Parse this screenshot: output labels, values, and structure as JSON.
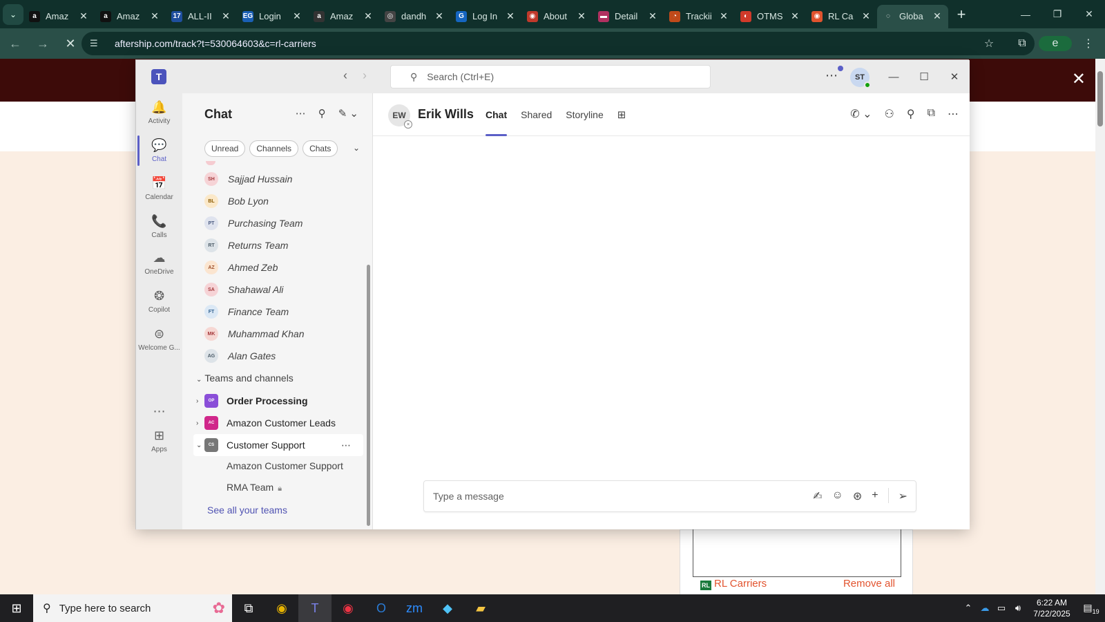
{
  "browser": {
    "tabs": [
      {
        "label": "Amaz",
        "fav": "a",
        "color": "#111111"
      },
      {
        "label": "Amaz",
        "fav": "a",
        "color": "#111111"
      },
      {
        "label": "ALL-II",
        "fav": "17",
        "color": "#1f4f9e"
      },
      {
        "label": "Login",
        "fav": "EG",
        "color": "#1a5fb4"
      },
      {
        "label": "Amaz",
        "fav": "a",
        "color": "#333333"
      },
      {
        "label": "dandh",
        "fav": "◎",
        "color": "#444444"
      },
      {
        "label": "Log In",
        "fav": "G",
        "color": "#1565c0"
      },
      {
        "label": "About",
        "fav": "◉",
        "color": "#c0392b"
      },
      {
        "label": "Detail",
        "fav": "▬",
        "color": "#b03060"
      },
      {
        "label": "Trackii",
        "fav": "◔",
        "color": "#c04a1a"
      },
      {
        "label": "OTMS",
        "fav": "◐",
        "color": "#d03a2a"
      },
      {
        "label": "RL Ca",
        "fav": "◉",
        "color": "#e0532e"
      },
      {
        "label": "Globa",
        "fav": "◌",
        "color": "#2a4f48"
      }
    ],
    "url": "aftership.com/track?t=530064603&c=rl-carriers",
    "profile_initial": "e"
  },
  "page": {
    "carrier": "RL Carriers",
    "remove_all": "Remove all",
    "rl_logo": "RL"
  },
  "taskbar": {
    "search_placeholder": "Type here to search",
    "time": "6:22 AM",
    "date": "7/22/2025",
    "notifications": "19"
  },
  "teams": {
    "search_placeholder": "Search (Ctrl+E)",
    "user_initials": "ST",
    "rail": [
      {
        "label": "Activity",
        "icon": "🔔"
      },
      {
        "label": "Chat",
        "icon": "💬"
      },
      {
        "label": "Calendar",
        "icon": "📅"
      },
      {
        "label": "Calls",
        "icon": "📞"
      },
      {
        "label": "OneDrive",
        "icon": "☁"
      },
      {
        "label": "Copilot",
        "icon": "❂"
      },
      {
        "label": "Welcome G...",
        "icon": "⊜"
      },
      {
        "label": "Apps",
        "icon": "⊞"
      }
    ],
    "panel": {
      "title": "Chat",
      "filters": [
        "Unread",
        "Channels",
        "Chats"
      ],
      "chats": [
        {
          "initials": "SH",
          "name": "Sajjad Hussain",
          "bg": "#f6d3d6",
          "fg": "#a4373a"
        },
        {
          "initials": "BL",
          "name": "Bob Lyon",
          "bg": "#fbe8c8",
          "fg": "#8a5a00"
        },
        {
          "initials": "PT",
          "name": "Purchasing Team",
          "bg": "#dfe3ee",
          "fg": "#4a5a80"
        },
        {
          "initials": "RT",
          "name": "Returns Team",
          "bg": "#dde3e8",
          "fg": "#4a5a66"
        },
        {
          "initials": "AZ",
          "name": "Ahmed Zeb",
          "bg": "#fbe5d0",
          "fg": "#a0522d"
        },
        {
          "initials": "SA",
          "name": "Shahawal Ali",
          "bg": "#f6d3d6",
          "fg": "#a4373a"
        },
        {
          "initials": "FT",
          "name": "Finance Team",
          "bg": "#dbe8f5",
          "fg": "#2f5f8f"
        },
        {
          "initials": "MK",
          "name": "Muhammad Khan",
          "bg": "#f6d7d3",
          "fg": "#a4373a"
        },
        {
          "initials": "AG",
          "name": "Alan Gates",
          "bg": "#dde3e8",
          "fg": "#4a5a66"
        }
      ],
      "teams_header": "Teams and channels",
      "teams": [
        {
          "initials": "OP",
          "name": "Order Processing",
          "color": "#8a4ed8",
          "bold": true
        },
        {
          "initials": "AC",
          "name": "Amazon Customer Leads",
          "color": "#d0278a",
          "bold": false
        },
        {
          "initials": "CS",
          "name": "Customer Support",
          "color": "#777777",
          "bold": false
        }
      ],
      "channels": [
        "Amazon Customer Support",
        "RMA Team"
      ],
      "see_all": "See all your teams"
    },
    "conversation": {
      "initials": "EW",
      "name": "Erik Wills",
      "tabs": [
        "Chat",
        "Shared",
        "Storyline"
      ],
      "compose_placeholder": "Type a message"
    }
  }
}
